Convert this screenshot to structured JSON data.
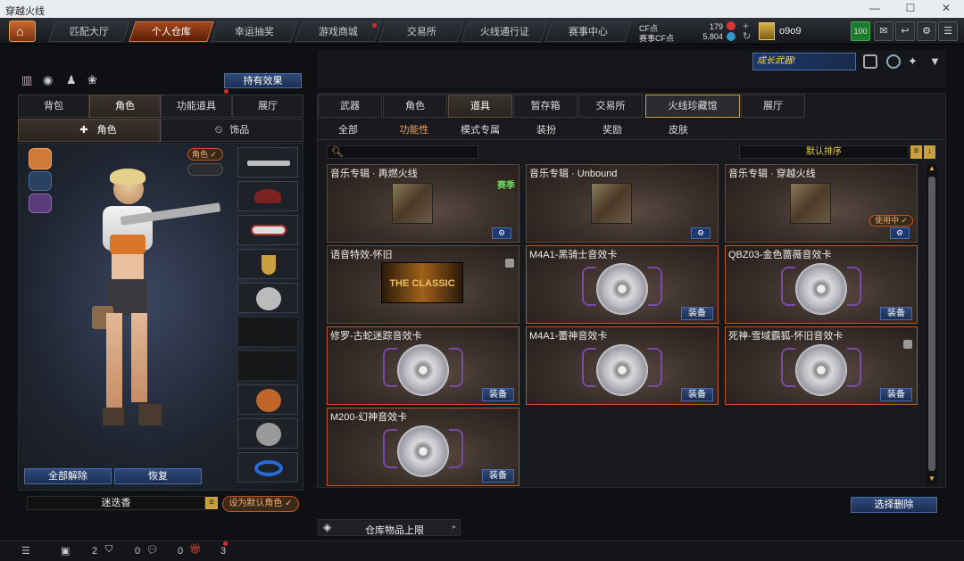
{
  "window": {
    "title": "穿越火线"
  },
  "nav": {
    "tabs": [
      "匹配大厅",
      "个人仓库",
      "幸运抽奖",
      "游戏商城",
      "交易所",
      "火线通行证",
      "赛事中心"
    ],
    "active": 1,
    "cf_label": "CF点",
    "cf_value": "179",
    "event_cf_label": "赛事CF点",
    "event_cf_value": "5,804",
    "username": "o9o9",
    "level": "100",
    "promo": "成长武器!"
  },
  "left": {
    "effects_button": "持有效果",
    "tabs": [
      "背包",
      "角色",
      "功能道具",
      "展厅"
    ],
    "active_tab": 1,
    "subtabs": [
      "角色",
      "饰品"
    ],
    "role_tag": "角色",
    "remove_all": "全部解除",
    "restore": "恢复",
    "character_name": "迷迭香",
    "set_default": "设为默认角色"
  },
  "right": {
    "tabs": [
      "武器",
      "角色",
      "道具",
      "暂存箱",
      "交易所",
      "火线珍藏馆",
      "展厅"
    ],
    "active_tab": 2,
    "subtabs": [
      "全部",
      "功能性",
      "模式专属",
      "装扮",
      "奖励",
      "皮肤"
    ],
    "active_subtab": 1,
    "search_placeholder": "",
    "sort_label": "默认排序",
    "items": [
      {
        "name": "音乐专辑 · 再燃火线",
        "badge": "赛季",
        "type": "album",
        "action": "⚙"
      },
      {
        "name": "音乐专辑 · Unbound",
        "badge": "",
        "type": "album",
        "action": "⚙"
      },
      {
        "name": "音乐专辑 · 穿越火线",
        "badge": "使用中",
        "type": "album",
        "action": "⚙"
      },
      {
        "name": "语音特效-怀旧",
        "badge": "",
        "type": "classic",
        "action": "",
        "image_text": "THE CLASSIC"
      },
      {
        "name": "M4A1-黑骑士音效卡",
        "badge": "",
        "type": "disc",
        "action": "装备"
      },
      {
        "name": "QBZ03-金色蔷薇音效卡",
        "badge": "",
        "type": "disc",
        "action": "装备"
      },
      {
        "name": "修罗-古蛇迷踪音效卡",
        "badge": "",
        "type": "disc",
        "action": "装备"
      },
      {
        "name": "M4A1-蕾神音效卡",
        "badge": "",
        "type": "disc",
        "action": "装备"
      },
      {
        "name": "死神-雪域霸狐-怀旧音效卡",
        "badge": "",
        "type": "disc",
        "action": "装备"
      },
      {
        "name": "M200-幻神音效卡",
        "badge": "",
        "type": "disc",
        "action": "装备"
      }
    ],
    "select_delete": "选择删除",
    "warehouse_limit": "仓库物品上限"
  },
  "bottom": {
    "count_a": "2",
    "count_b": "0",
    "count_c": "0",
    "count_d": "3"
  },
  "colors": {
    "accent": "#c1541f",
    "button_blue": "#1c2e52"
  }
}
